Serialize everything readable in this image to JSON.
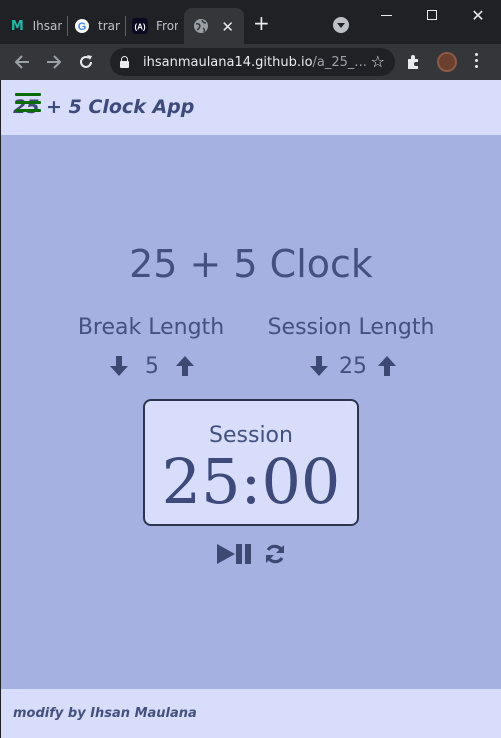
{
  "browser": {
    "tabs": [
      {
        "title": "Ihsan",
        "icon": "m-logo-icon"
      },
      {
        "title": "trans",
        "icon": "google-icon"
      },
      {
        "title": "Front",
        "icon": "freecodecamp-icon"
      },
      {
        "title": "",
        "icon": "globe-icon",
        "active": true
      }
    ],
    "url_domain": "ihsanmaulana14.github.io",
    "url_path": "/a_25_...",
    "colors": {
      "chrome_dark": "#202124",
      "chrome_toolbar": "#35363a"
    }
  },
  "app": {
    "header_title": "25 + 5 Clock App",
    "main_title": "25 + 5 Clock",
    "break_label": "Break Length",
    "break_value": "5",
    "session_label": "Session Length",
    "session_value": "25",
    "timer_label": "Session",
    "timer_value": "25:00",
    "footer_text": "modify by Ihsan Maulana",
    "colors": {
      "background": "#a5b1e0",
      "panel": "#d7ddfb",
      "text": "#44507e",
      "hamburger": "#0a6b0a"
    }
  }
}
